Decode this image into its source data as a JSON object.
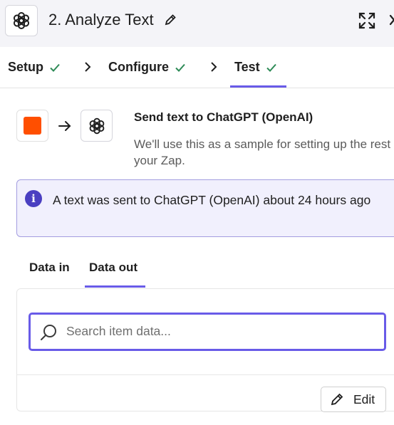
{
  "header": {
    "step_title": "2. Analyze Text",
    "icons": [
      "openai-logo-icon",
      "pencil-icon",
      "expand-icon",
      "close-icon"
    ]
  },
  "step_tabs": {
    "setup": "Setup",
    "configure": "Configure",
    "test": "Test",
    "active": "Test"
  },
  "flow": {
    "title": "Send text to ChatGPT (OpenAI)",
    "description": "We'll use this as a sample for setting up the rest of your Zap."
  },
  "info_banner": {
    "message": "A text was sent to ChatGPT (OpenAI) about 24 hours ago"
  },
  "data_tabs": {
    "data_in": "Data in",
    "data_out": "Data out",
    "active": "Data out"
  },
  "search": {
    "placeholder": "Search item data..."
  },
  "actions": {
    "edit_label": "Edit"
  },
  "colors": {
    "accent": "#695be8",
    "success_check": "#2e8b57",
    "trigger_app": "#ff4f00",
    "info_bg": "#f1f0fd",
    "info_icon": "#4a3fc1",
    "header_bg": "#f4f4f8"
  }
}
